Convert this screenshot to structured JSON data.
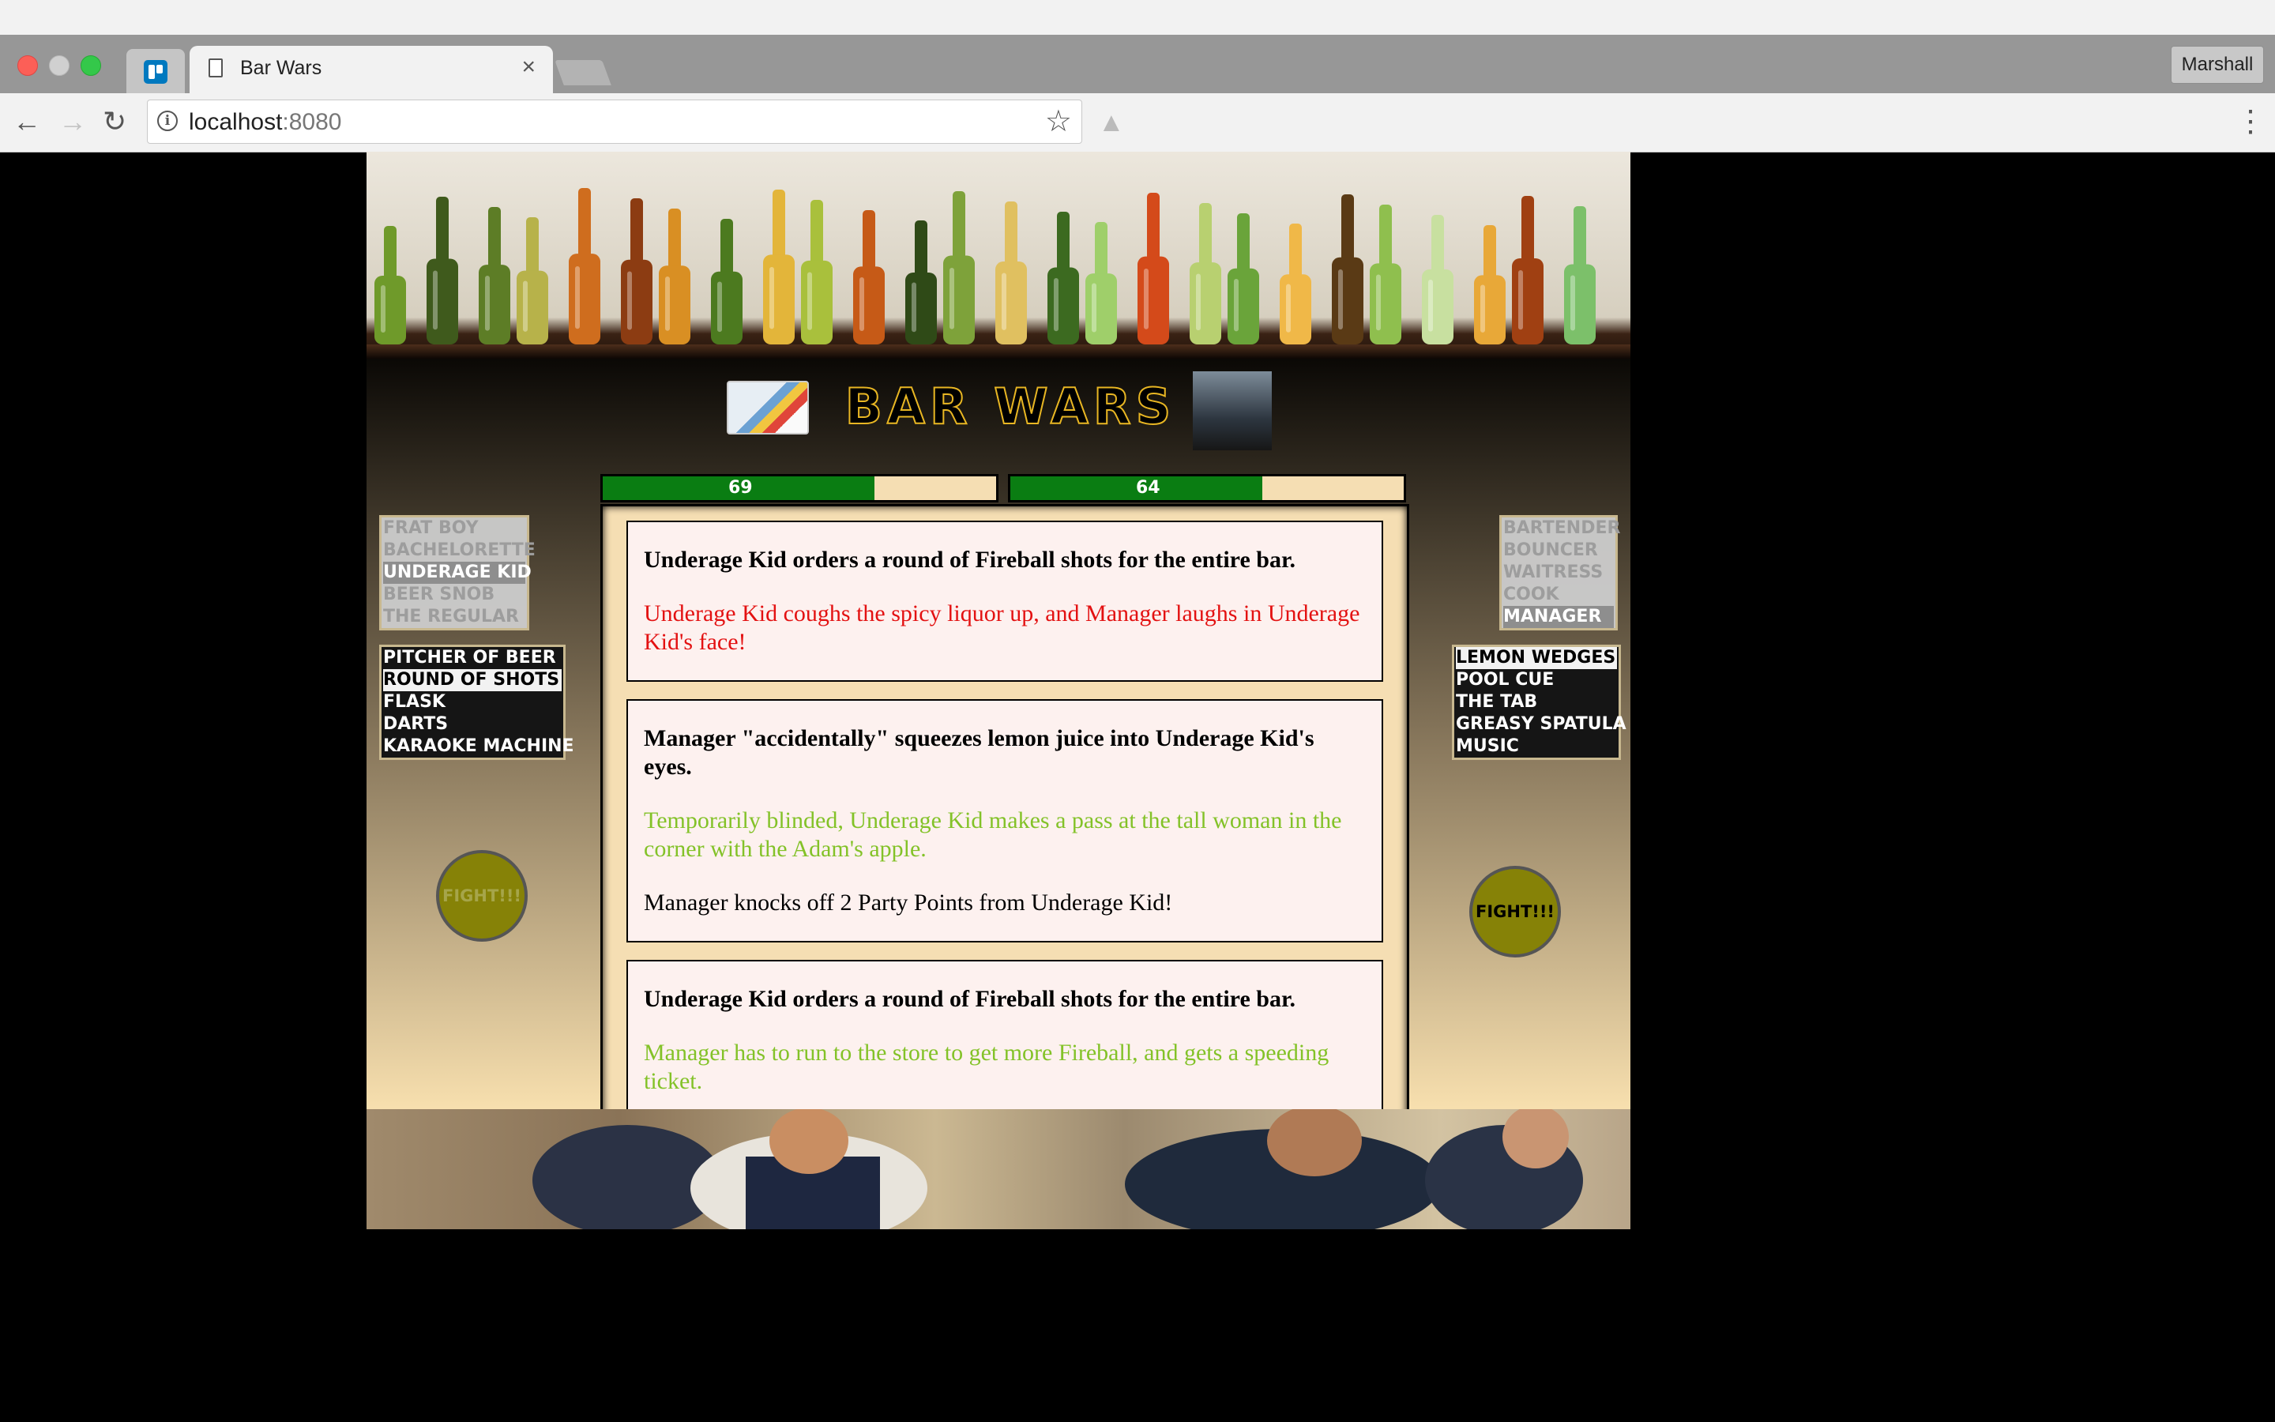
{
  "browser": {
    "tab_title": "Bar Wars",
    "tab_close": "×",
    "profile": "Marshall",
    "url_host": "localhost",
    "url_port": ":8080"
  },
  "game": {
    "title": "BAR WARS",
    "player_hp": 69,
    "player_hp_fraction": 0.69,
    "enemy_hp": 64,
    "enemy_hp_fraction": 0.64,
    "player_characters": [
      "FRAT BOY",
      "BACHELORETTE",
      "UNDERAGE KID",
      "BEER SNOB",
      "THE REGULAR"
    ],
    "player_selected_character": "UNDERAGE KID",
    "player_actions": [
      "PITCHER OF BEER",
      "ROUND OF SHOTS",
      "FLASK",
      "DARTS",
      "KARAOKE MACHINE"
    ],
    "player_selected_action": "ROUND OF SHOTS",
    "enemy_characters": [
      "BARTENDER",
      "BOUNCER",
      "WAITRESS",
      "COOK",
      "MANAGER"
    ],
    "enemy_selected_character": "MANAGER",
    "enemy_actions": [
      "LEMON WEDGES",
      "POOL CUE",
      "THE TAB",
      "GREASY SPATULA",
      "MUSIC"
    ],
    "enemy_selected_action": "LEMON WEDGES",
    "fight_label": "FIGHT!!!",
    "log": [
      {
        "action": "Underage Kid orders a round of Fireball shots for the entire bar.",
        "results": [
          {
            "text": "Underage Kid coughs the spicy liquor up, and Manager laughs in Underage Kid's face!",
            "kind": "fail"
          }
        ]
      },
      {
        "action": "Manager \"accidentally\" squeezes lemon juice into Underage Kid's eyes.",
        "results": [
          {
            "text": "Temporarily blinded, Underage Kid makes a pass at the tall woman in the corner with the Adam's apple.",
            "kind": "success"
          },
          {
            "text": "Manager knocks off 2 Party Points from Underage Kid!",
            "kind": "points"
          }
        ]
      },
      {
        "action": "Underage Kid orders a round of Fireball shots for the entire bar.",
        "results": [
          {
            "text": "Manager has to run to the store to get more Fireball, and gets a speeding ticket.",
            "kind": "success"
          }
        ]
      }
    ]
  },
  "colors": {
    "fail": "#e31111",
    "success": "#83c228",
    "hp_fill": "#0a7d12",
    "fight_button": "#868207",
    "title_outline": "#e8b623"
  }
}
